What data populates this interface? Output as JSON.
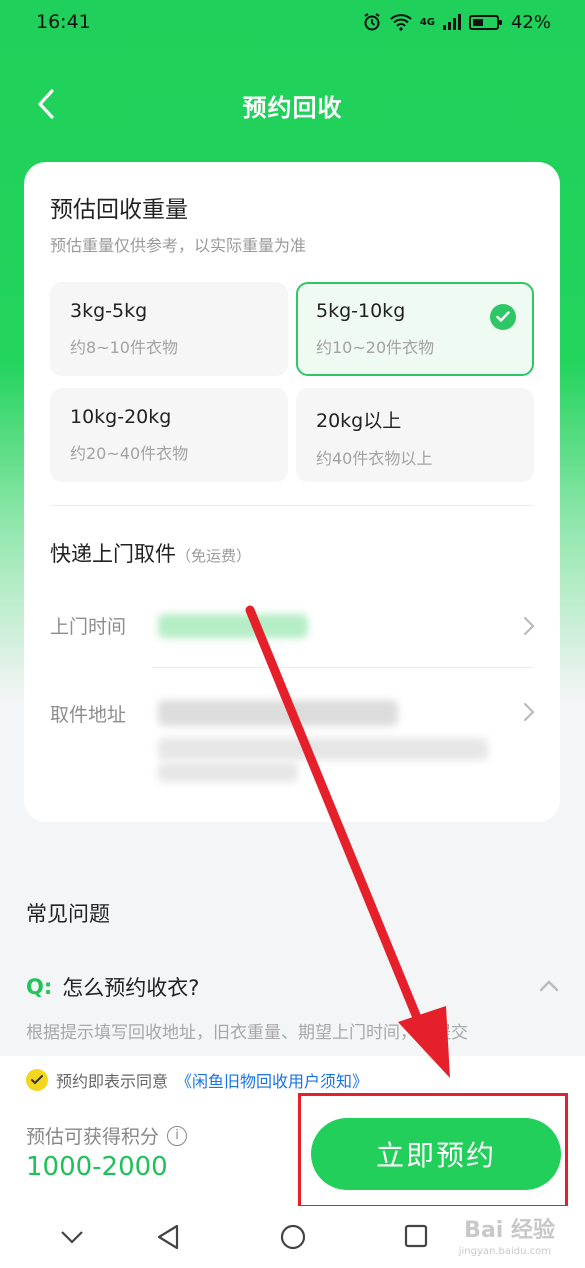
{
  "status_bar": {
    "time": "16:41",
    "network": "4G",
    "battery": "42%"
  },
  "header": {
    "title": "预约回收"
  },
  "weight": {
    "title": "预估回收重量",
    "subtitle": "预估重量仅供参考，以实际重量为准",
    "options": [
      {
        "range": "3kg-5kg",
        "desc": "约8~10件衣物",
        "selected": false
      },
      {
        "range": "5kg-10kg",
        "desc": "约10~20件衣物",
        "selected": true
      },
      {
        "range": "10kg-20kg",
        "desc": "约20~40件衣物",
        "selected": false
      },
      {
        "range": "20kg以上",
        "desc": "约40件衣物以上",
        "selected": false
      }
    ]
  },
  "pickup": {
    "title": "快递上门取件",
    "note": "（免运费）",
    "time_label": "上门时间",
    "address_label": "取件地址"
  },
  "faq": {
    "title": "常见问题",
    "q_mark": "Q:",
    "question": "怎么预约收衣?",
    "answer": "根据提示填写回收地址，旧衣重量、期望上门时间，并提交"
  },
  "bottom": {
    "agree_text": "预约即表示同意",
    "agree_link": "《闲鱼旧物回收用户须知》",
    "points_label": "预估可获得积分",
    "points_value": "1000-2000",
    "book_button": "立即预约"
  },
  "watermark": {
    "brand": "Bai 经验",
    "url": "jingyan.baidu.com"
  },
  "colors": {
    "primary_green": "#22cf5a",
    "link_blue": "#1a73e8",
    "annotation_red": "#e5202a"
  }
}
